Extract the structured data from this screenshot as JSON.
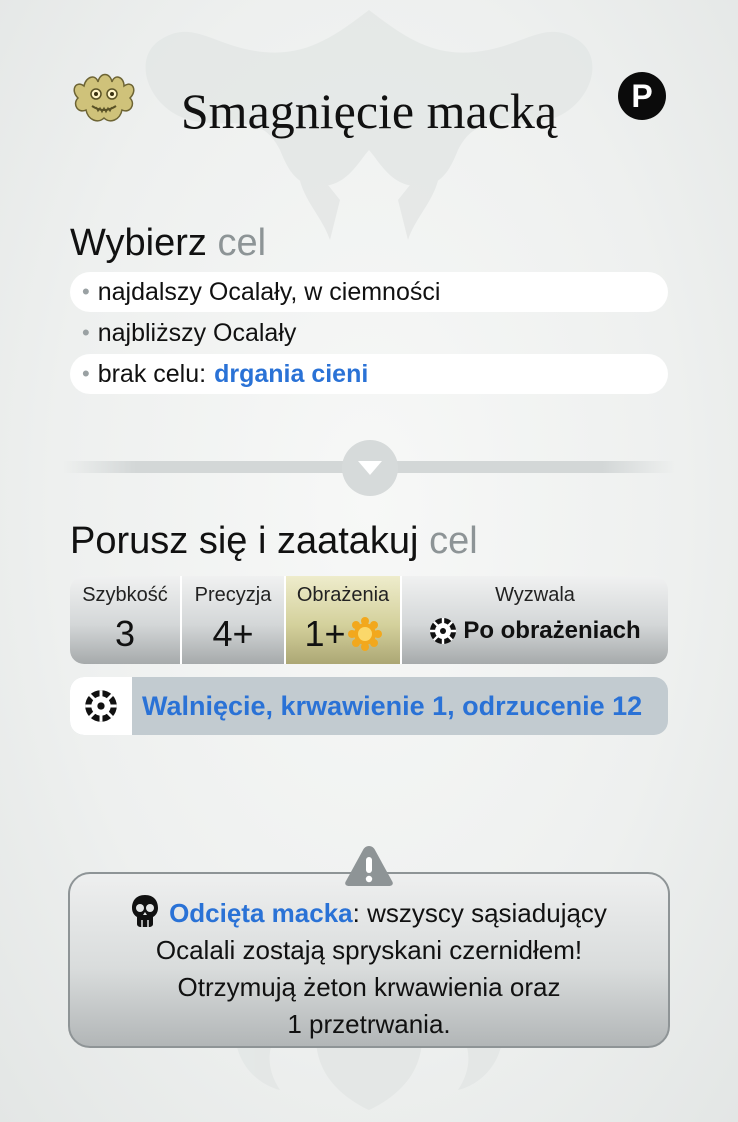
{
  "header": {
    "title": "Smagnięcie macką",
    "badge": "P",
    "monster_icon": "monster-head-icon"
  },
  "target_section": {
    "heading_main": "Wybierz",
    "heading_muted": "cel",
    "options": [
      {
        "text": "najdalszy Ocalały, w ciemności"
      },
      {
        "text": "najbliższy Ocalały"
      },
      {
        "text": "brak celu:",
        "keyword": "drgania cieni"
      }
    ]
  },
  "divider": {
    "icon": "chevron-down-icon"
  },
  "attack_section": {
    "heading_main": "Porusz się i zaatakuj",
    "heading_muted": "cel",
    "stats": {
      "speed_label": "Szybkość",
      "speed_value": "3",
      "accuracy_label": "Precyzja",
      "accuracy_value": "4+",
      "damage_label": "Obrażenia",
      "damage_value": "1+",
      "damage_icon": "burst-icon",
      "trigger_label": "Wyzwala",
      "trigger_value": "Po obrażeniach",
      "trigger_icon": "ring-icon"
    },
    "effect": {
      "icon": "ring-icon",
      "text": "Walnięcie, krwawienie 1, odrzucenie 12"
    }
  },
  "trait": {
    "icon": "skull-icon",
    "warning_icon": "warning-icon",
    "name": "Odcięta macka",
    "line1_rest": ": wszyscy sąsiadujący",
    "line2": "Ocalali zostają spryskani czernidłem!",
    "line3": "Otrzymują żeton krwawienia oraz",
    "line4": "1 przetrwania."
  },
  "colors": {
    "keyword_blue": "#2a72d6",
    "muted_gray": "#8d9496",
    "damage_gold": "#d4d19c",
    "effect_bar": "#c2cbd0"
  }
}
